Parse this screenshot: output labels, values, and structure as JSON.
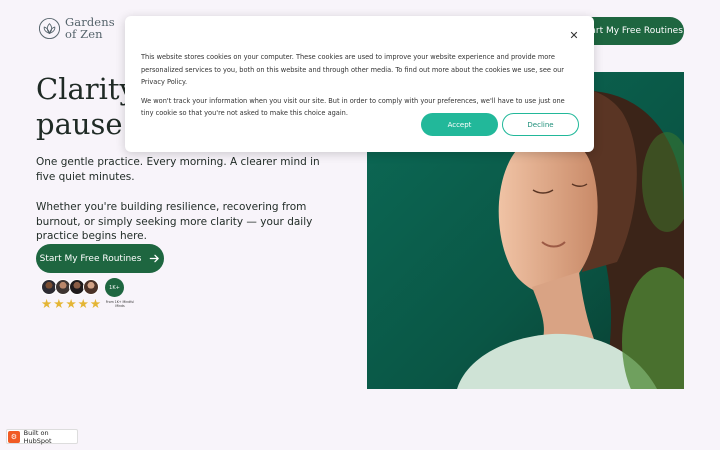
{
  "brand": {
    "line1": "Gardens",
    "line2": "of Zen",
    "logo_icon": "lotus-icon",
    "accent": "#1e6640"
  },
  "header": {
    "cta_label": "Start My Free Routines"
  },
  "hero": {
    "title": "Clarity begins with a pause.",
    "subline": "One gentle practice. Every morning. A clearer mind in five quiet minutes.",
    "body": "Whether you're building resilience, recovering from burnout, or simply seeking more clarity — your daily practice begins here.",
    "cta_label": "Start My Free Routines",
    "cta_icon": "arrow-right-icon",
    "social_proof": {
      "count_badge": "1K+",
      "badge_label": "From 1K+ Mindful Minds",
      "star_rating": 5,
      "star_color": "#e4b534"
    }
  },
  "cookie_banner": {
    "close_icon": "close-icon",
    "paragraph_1": "This website stores cookies on your computer. These cookies are used to improve your website experience and provide more personalized services to you, both on this website and through other media. To find out more about the cookies we use, see our Privacy Policy.",
    "paragraph_2": "We won't track your information when you visit our site. But in order to comply with your preferences, we'll have to use just one tiny cookie so that you're not asked to make this choice again.",
    "accept_label": "Accept",
    "decline_label": "Decline",
    "accept_color": "#22b89a"
  },
  "hubspot": {
    "label": "Built on HubSpot",
    "icon": "hubspot-sprocket-icon"
  }
}
